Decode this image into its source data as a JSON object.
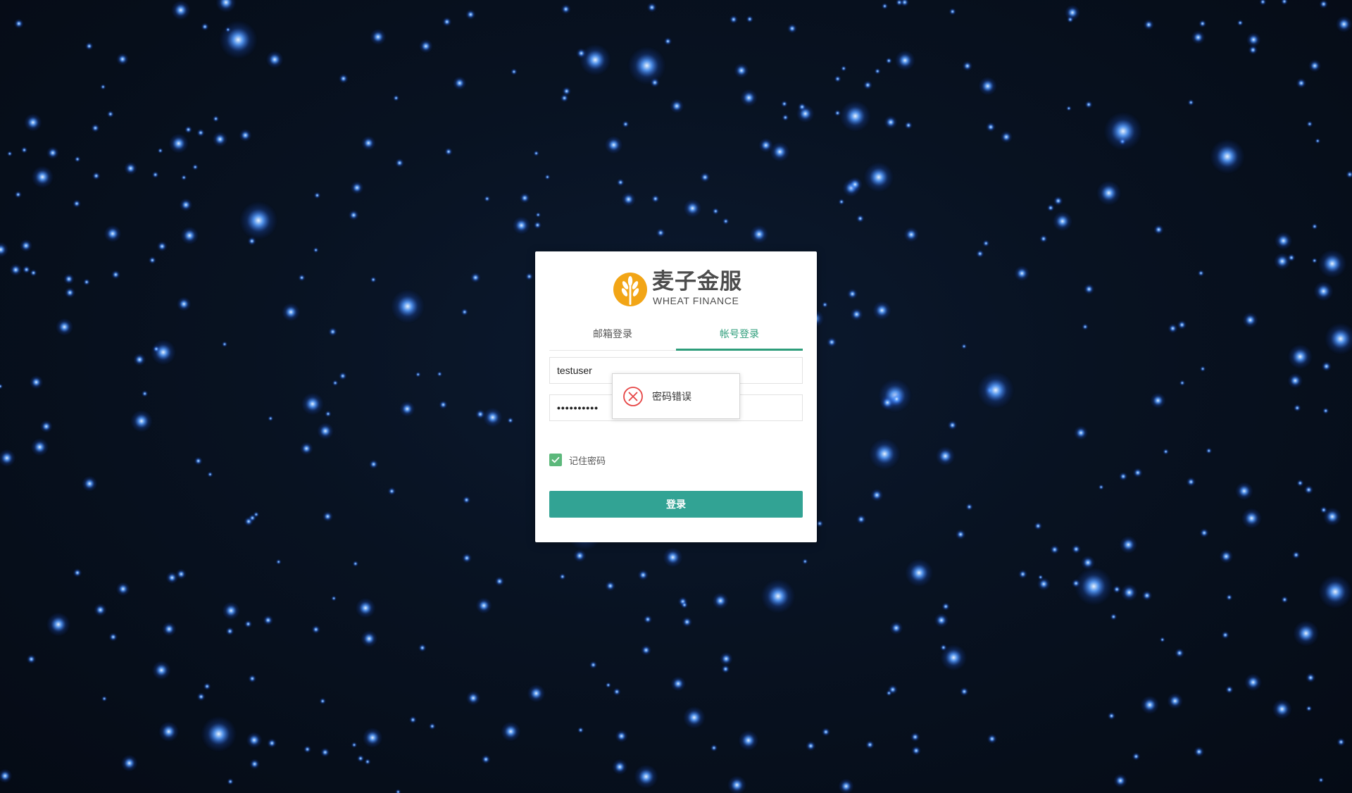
{
  "brand": {
    "name": "麦子金服",
    "subtitle": "WHEAT FINANCE",
    "icon": "wheat-logo-icon",
    "color": "#f0a500"
  },
  "tabs": [
    {
      "label": "邮箱登录",
      "active": false
    },
    {
      "label": "帐号登录",
      "active": true
    }
  ],
  "form": {
    "username_value": "testuser",
    "password_value": "••••••••••",
    "remember_label": "记住密码",
    "remember_checked": true,
    "submit_label": "登录"
  },
  "toast": {
    "message": "密码错误",
    "icon": "error-x-icon"
  },
  "colors": {
    "accent": "#2d9d7a",
    "button": "#32a394",
    "checkbox": "#5cb87b",
    "error": "#e64545",
    "background": "#081221"
  }
}
